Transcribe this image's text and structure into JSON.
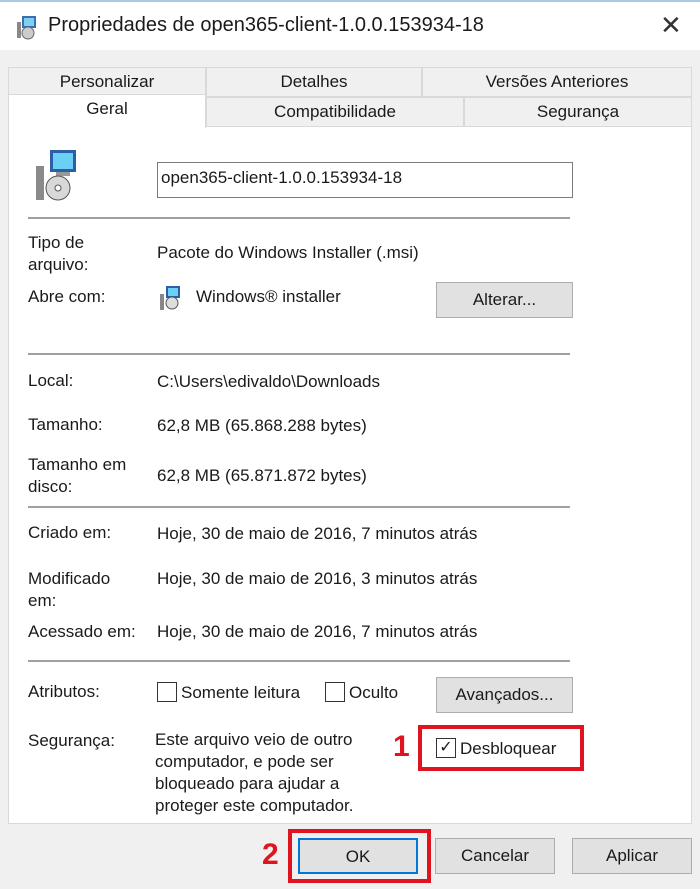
{
  "window": {
    "title": "Propriedades de open365-client-1.0.0.153934-18",
    "close": "✕"
  },
  "tabs": {
    "row1": [
      "Personalizar",
      "Detalhes",
      "Versões Anteriores"
    ],
    "row2": [
      "Geral",
      "Compatibilidade",
      "Segurança"
    ],
    "active": "Geral"
  },
  "general": {
    "filename": "open365-client-1.0.0.153934-18",
    "type_label": "Tipo de arquivo:",
    "type_value": "Pacote do Windows Installer (.msi)",
    "opens_label": "Abre com:",
    "opens_value": "Windows® installer",
    "change_button": "Alterar...",
    "location_label": "Local:",
    "location_value": "C:\\Users\\edivaldo\\Downloads",
    "size_label": "Tamanho:",
    "size_value": "62,8 MB (65.868.288 bytes)",
    "disk_label": "Tamanho em disco:",
    "disk_value": "62,8 MB (65.871.872 bytes)",
    "created_label": "Criado em:",
    "created_value": "Hoje, 30 de maio de 2016, 7 minutos atrás",
    "modified_label": "Modificado em:",
    "modified_value": "Hoje, 30 de maio de 2016, 3 minutos atrás",
    "accessed_label": "Acessado em:",
    "accessed_value": "Hoje, 30 de maio de 2016, 7 minutos atrás",
    "attributes_label": "Atributos:",
    "readonly": "Somente leitura",
    "hidden": "Oculto",
    "advanced_button": "Avançados...",
    "security_label": "Segurança:",
    "security_text": "Este arquivo veio de outro computador, e pode ser bloqueado para ajudar a proteger este computador.",
    "unblock": "Desbloquear",
    "unblock_checked": true
  },
  "buttons": {
    "ok": "OK",
    "cancel": "Cancelar",
    "apply": "Aplicar"
  },
  "annotations": {
    "step1": "1",
    "step2": "2",
    "color": "#e0141e"
  }
}
